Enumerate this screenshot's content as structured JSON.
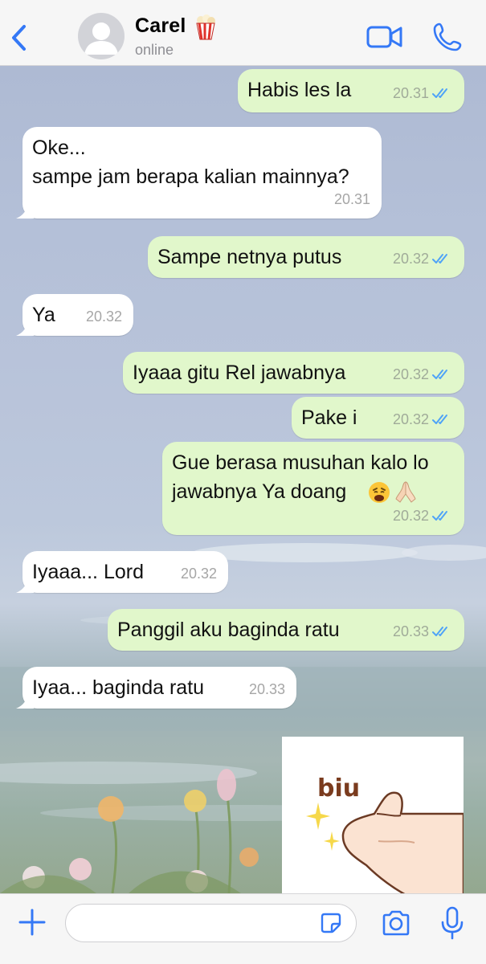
{
  "header": {
    "contact_name": "Carel",
    "name_emoji": "popcorn-icon",
    "status": "online",
    "back_icon": "chevron-left-icon",
    "video_icon": "video-call-icon",
    "phone_icon": "phone-icon"
  },
  "messages": [
    {
      "direction": "out",
      "text": "Habis les la",
      "time": "20.31",
      "read": true
    },
    {
      "direction": "in",
      "lines": [
        "Oke...",
        "sampe jam berapa kalian mainnya?"
      ],
      "time": "20.31"
    },
    {
      "direction": "out",
      "text": "Sampe netnya putus",
      "time": "20.32",
      "read": true
    },
    {
      "direction": "in",
      "text": "Ya",
      "time": "20.32"
    },
    {
      "direction": "out",
      "text": "Iyaaa gitu Rel jawabnya",
      "time": "20.32",
      "read": true
    },
    {
      "direction": "out",
      "text": "Pake i",
      "time": "20.32",
      "read": true
    },
    {
      "direction": "out",
      "lines": [
        "Gue berasa musuhan kalo lo",
        "jawabnya Ya doang"
      ],
      "emojis": [
        "weary-face-icon",
        "folded-hands-icon"
      ],
      "time": "20.32",
      "read": true
    },
    {
      "direction": "in",
      "text": "Iyaaa... Lord",
      "time": "20.32"
    },
    {
      "direction": "out",
      "text": "Panggil aku baginda ratu",
      "time": "20.33",
      "read": true
    },
    {
      "direction": "in",
      "text": "Iyaa... baginda ratu",
      "time": "20.33"
    },
    {
      "direction": "out",
      "type": "sticker",
      "sticker_text": "biu"
    }
  ],
  "input_bar": {
    "placeholder": "",
    "icons": [
      "plus-icon",
      "sticker-icon",
      "camera-icon",
      "microphone-icon"
    ]
  },
  "colors": {
    "accent": "#3478f6",
    "outgoing_bubble": "#e1f7cb",
    "incoming_bubble": "#ffffff",
    "read_ticks": "#4fa3f7"
  }
}
